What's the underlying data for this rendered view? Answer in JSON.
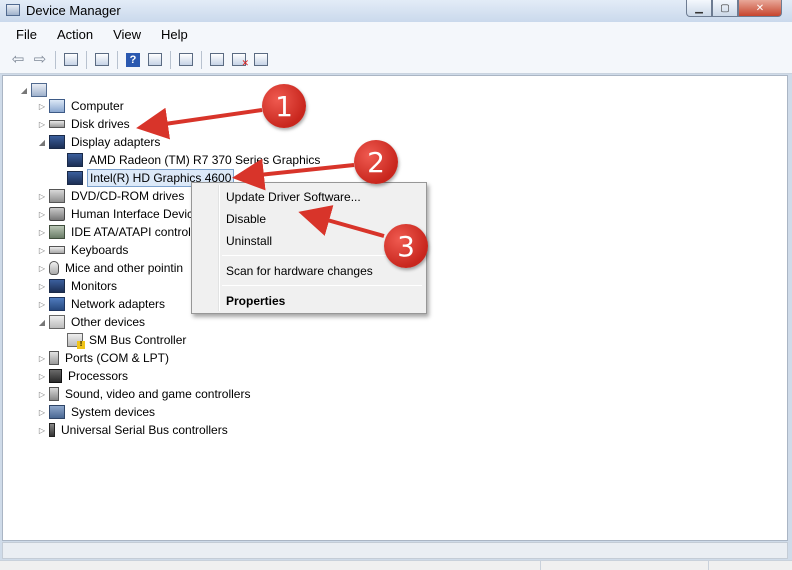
{
  "window": {
    "title": "Device Manager"
  },
  "menu": [
    "File",
    "Action",
    "View",
    "Help"
  ],
  "toolbar": {
    "icons": [
      "back-icon",
      "forward-icon",
      "show-hide-console-tree-icon",
      "properties-icon",
      "help-icon",
      "action-pane-icon",
      "scan-hardware-icon",
      "update-driver-icon",
      "uninstall-icon",
      "disable-icon"
    ]
  },
  "tree": {
    "categories": [
      {
        "label": "Computer",
        "icon": "computer-icon"
      },
      {
        "label": "Disk drives",
        "icon": "disk-drive-icon"
      },
      {
        "label": "Display adapters",
        "icon": "display-adapter-icon"
      },
      {
        "label": "AMD Radeon (TM) R7 370 Series Graphics",
        "icon": "display-adapter-icon"
      },
      {
        "label": "Intel(R) HD Graphics 4600",
        "icon": "display-adapter-icon"
      },
      {
        "label": "DVD/CD-ROM drives",
        "icon": "dvd-drive-icon"
      },
      {
        "label": "Human Interface Devic",
        "icon": "hid-icon"
      },
      {
        "label": "IDE ATA/ATAPI control",
        "icon": "ide-controller-icon"
      },
      {
        "label": "Keyboards",
        "icon": "keyboard-icon"
      },
      {
        "label": "Mice and other pointin",
        "icon": "mouse-icon"
      },
      {
        "label": "Monitors",
        "icon": "monitor-icon"
      },
      {
        "label": "Network adapters",
        "icon": "network-adapter-icon"
      },
      {
        "label": "Other devices",
        "icon": "other-devices-icon"
      },
      {
        "label": "SM Bus Controller",
        "icon": "unknown-device-warning-icon"
      },
      {
        "label": "Ports (COM & LPT)",
        "icon": "port-icon"
      },
      {
        "label": "Processors",
        "icon": "processor-icon"
      },
      {
        "label": "Sound, video and game controllers",
        "icon": "sound-icon"
      },
      {
        "label": "System devices",
        "icon": "system-devices-icon"
      },
      {
        "label": "Universal Serial Bus controllers",
        "icon": "usb-icon"
      }
    ]
  },
  "context_menu": {
    "update_driver": "Update Driver Software...",
    "disable": "Disable",
    "uninstall": "Uninstall",
    "scan": "Scan for hardware changes",
    "properties": "Properties"
  },
  "callouts": [
    "1",
    "2",
    "3"
  ],
  "colors": {
    "callout": "#d8342a",
    "selection": "#dce9f8"
  }
}
